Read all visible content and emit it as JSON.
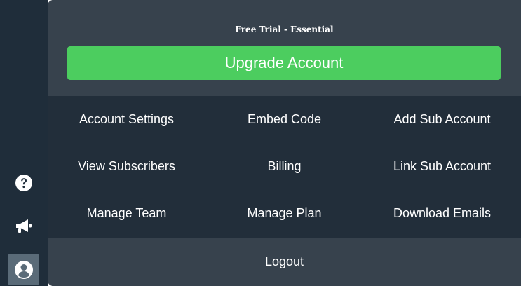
{
  "sidebar": {
    "icons": [
      {
        "name": "help-icon"
      },
      {
        "name": "megaphone-icon"
      },
      {
        "name": "user-account-icon"
      }
    ]
  },
  "header": {
    "plan_label": "Free Trial - Essential",
    "upgrade_label": "Upgrade Account"
  },
  "menu": {
    "items": [
      {
        "label": "Account Settings"
      },
      {
        "label": "Embed Code"
      },
      {
        "label": "Add Sub Account"
      },
      {
        "label": "View Subscribers"
      },
      {
        "label": "Billing"
      },
      {
        "label": "Link Sub Account"
      },
      {
        "label": "Manage Team"
      },
      {
        "label": "Manage Plan"
      },
      {
        "label": "Download Emails"
      }
    ]
  },
  "footer": {
    "logout_label": "Logout"
  },
  "colors": {
    "sidebar_bg": "#1f2d3a",
    "panel_bg": "#222e3a",
    "header_bg": "#37424d",
    "upgrade_green": "#4ccd5f",
    "active_icon_bg": "#5a6b78"
  }
}
